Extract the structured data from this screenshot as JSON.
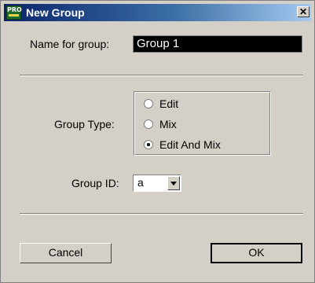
{
  "window": {
    "title": "New Group",
    "app_icon_text": "PRO",
    "close_glyph": "✕"
  },
  "form": {
    "name_label": "Name for group:",
    "name_value": "Group 1",
    "group_type_label": "Group Type:",
    "group_type_options": [
      "Edit",
      "Mix",
      "Edit And Mix"
    ],
    "group_type_selected": "Edit And Mix",
    "group_id_label": "Group ID:",
    "group_id_value": "a"
  },
  "buttons": {
    "cancel": "Cancel",
    "ok": "OK"
  },
  "colors": {
    "dialog_bg": "#d4d0c8",
    "titlebar_start": "#0a246a",
    "titlebar_end": "#a6caf0",
    "name_field_bg": "#000000"
  },
  "icons": {
    "app": "pro-tools-icon",
    "close": "close-icon",
    "dropdown": "chevron-down-icon"
  }
}
